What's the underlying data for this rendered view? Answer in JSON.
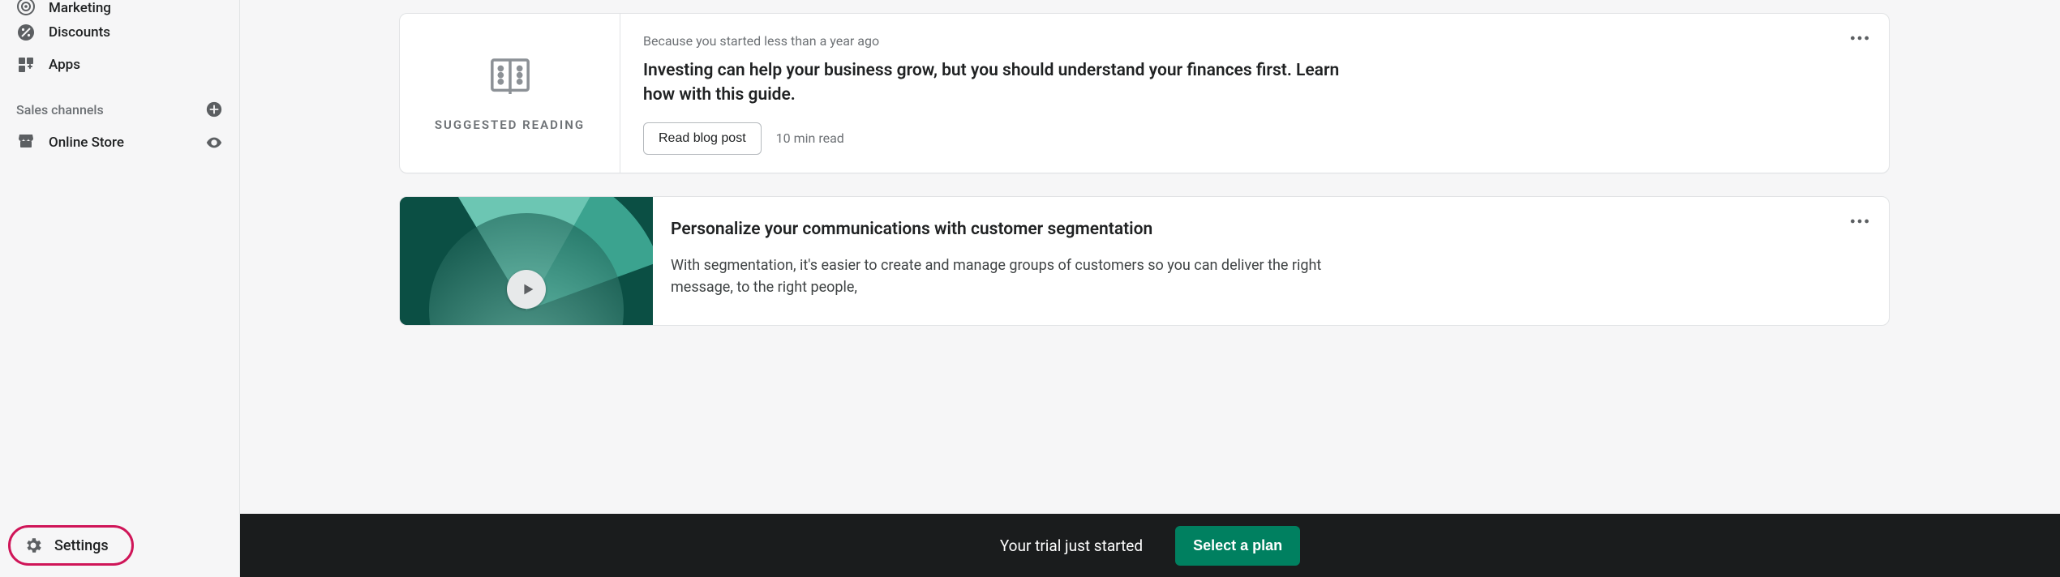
{
  "sidebar": {
    "items": [
      {
        "label": "Marketing"
      },
      {
        "label": "Discounts"
      },
      {
        "label": "Apps"
      }
    ],
    "section_label": "Sales channels",
    "online_store_label": "Online Store",
    "settings_label": "Settings"
  },
  "card1": {
    "caption": "SUGGESTED READING",
    "eyebrow": "Because you started less than a year ago",
    "title": "Investing can help your business grow, but you should understand your finances first. Learn how with this guide.",
    "button_label": "Read blog post",
    "meta": "10 min read"
  },
  "card2": {
    "title": "Personalize your communications with customer segmentation",
    "desc": "With segmentation, it's easier to create and manage groups of customers so you can deliver the right message, to the right people,"
  },
  "bottombar": {
    "message": "Your trial just started",
    "cta": "Select a plan"
  },
  "colors": {
    "accent_green": "#008060",
    "highlight_pink": "#cf1558"
  }
}
